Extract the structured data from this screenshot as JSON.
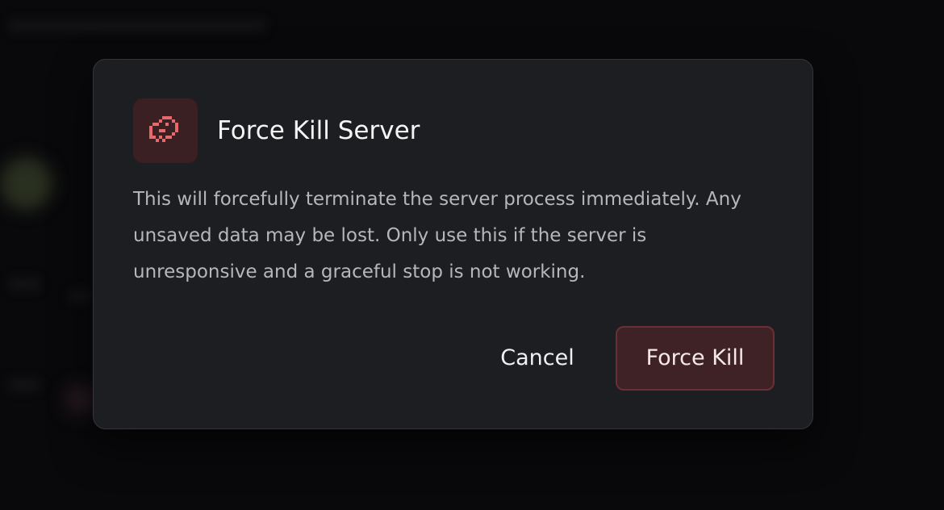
{
  "dialog": {
    "icon": "skull-icon",
    "title": "Force Kill Server",
    "message": "This will forcefully terminate the server process immediately. Any unsaved data may be lost. Only use this if the server is unresponsive and a graceful stop is not working.",
    "cancel_label": "Cancel",
    "confirm_label": "Force Kill"
  },
  "colors": {
    "danger_accent": "#e46a6e",
    "danger_bg": "#3f2226",
    "dialog_bg": "#1d1e21"
  }
}
